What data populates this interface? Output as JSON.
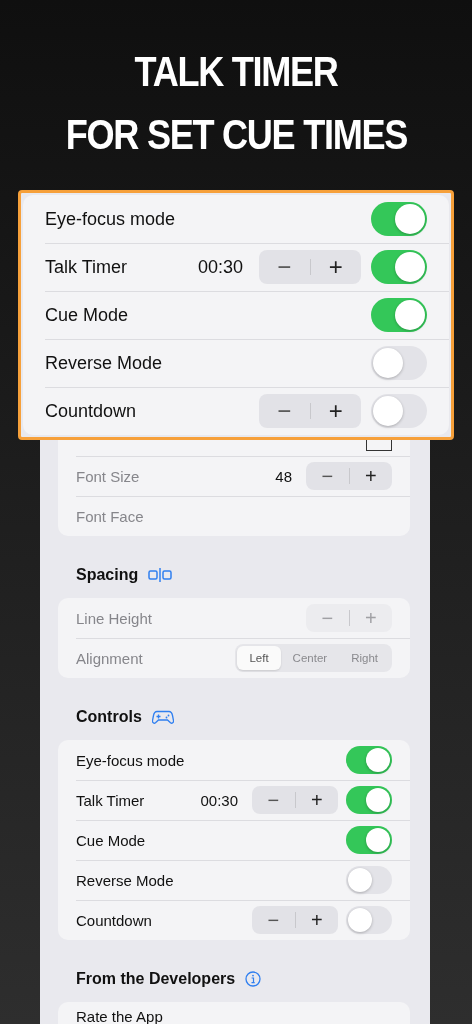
{
  "headline": [
    "TALK TIMER",
    "FOR SET CUE TIMES"
  ],
  "callout": {
    "rows": [
      {
        "label": "Eye-focus mode",
        "on": true
      },
      {
        "label": "Talk Timer",
        "value": "00:30",
        "stepper": {
          "minus": "−",
          "plus": "+",
          "disabled": false
        },
        "on": true
      },
      {
        "label": "Cue Mode",
        "on": true
      },
      {
        "label": "Reverse Mode",
        "on": false
      },
      {
        "label": "Countdown",
        "stepper": {
          "minus": "−",
          "plus": "+",
          "disabled": false
        },
        "on": false
      }
    ]
  },
  "phone": {
    "groups": [
      {
        "rows": [
          {
            "kind": "swatch"
          },
          {
            "label": "Font Size",
            "dimmed": true,
            "value": "48",
            "stepper": {
              "minus": "−",
              "plus": "+",
              "disabled": false
            }
          },
          {
            "label": "Font Face",
            "dimmed": true
          }
        ]
      },
      {
        "title": "Spacing",
        "rows": [
          {
            "label": "Line Height",
            "dimmed": true,
            "stepper": {
              "minus": "−",
              "plus": "+",
              "disabled": true
            }
          },
          {
            "label": "Alignment",
            "dimmed": true,
            "segments": [
              {
                "label": "Left",
                "selected": true
              },
              {
                "label": "Center",
                "selected": false
              },
              {
                "label": "Right",
                "selected": false
              }
            ]
          }
        ]
      },
      {
        "title": "Controls",
        "rows": [
          {
            "label": "Eye-focus mode",
            "on": true
          },
          {
            "label": "Talk Timer",
            "value": "00:30",
            "stepper": {
              "minus": "−",
              "plus": "+",
              "disabled": false
            },
            "on": true
          },
          {
            "label": "Cue Mode",
            "on": true
          },
          {
            "label": "Reverse Mode",
            "on": false
          },
          {
            "label": "Countdown",
            "stepper": {
              "minus": "−",
              "plus": "+",
              "disabled": false
            },
            "on": false
          }
        ]
      },
      {
        "title": "From the Developers",
        "rows": [
          {
            "label": "Rate the App",
            "kind": "link"
          }
        ]
      }
    ]
  }
}
